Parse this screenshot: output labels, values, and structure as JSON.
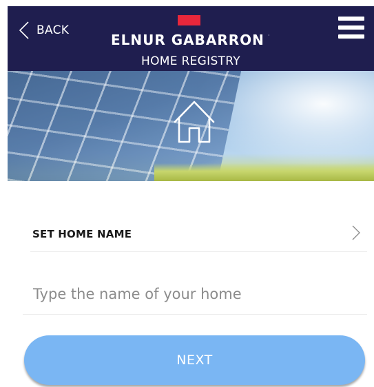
{
  "header": {
    "back_label": "BACK",
    "brand": "ELNUR GABARRON",
    "brand_mark": "·",
    "subtitle": "HOME REGISTRY",
    "back_icon": "chevron-left-icon",
    "menu_icon": "hamburger-menu-icon",
    "background_color": "#1f1e4f",
    "brand_accent_color": "#e8273b"
  },
  "hero": {
    "icon": "home-icon"
  },
  "form": {
    "set_home_name_label": "SET HOME NAME",
    "set_home_name_icon": "chevron-right-icon",
    "home_name_value": "",
    "home_name_placeholder": "Type the name of your home",
    "next_label": "NEXT",
    "next_button_color": "#7ab6f3"
  }
}
